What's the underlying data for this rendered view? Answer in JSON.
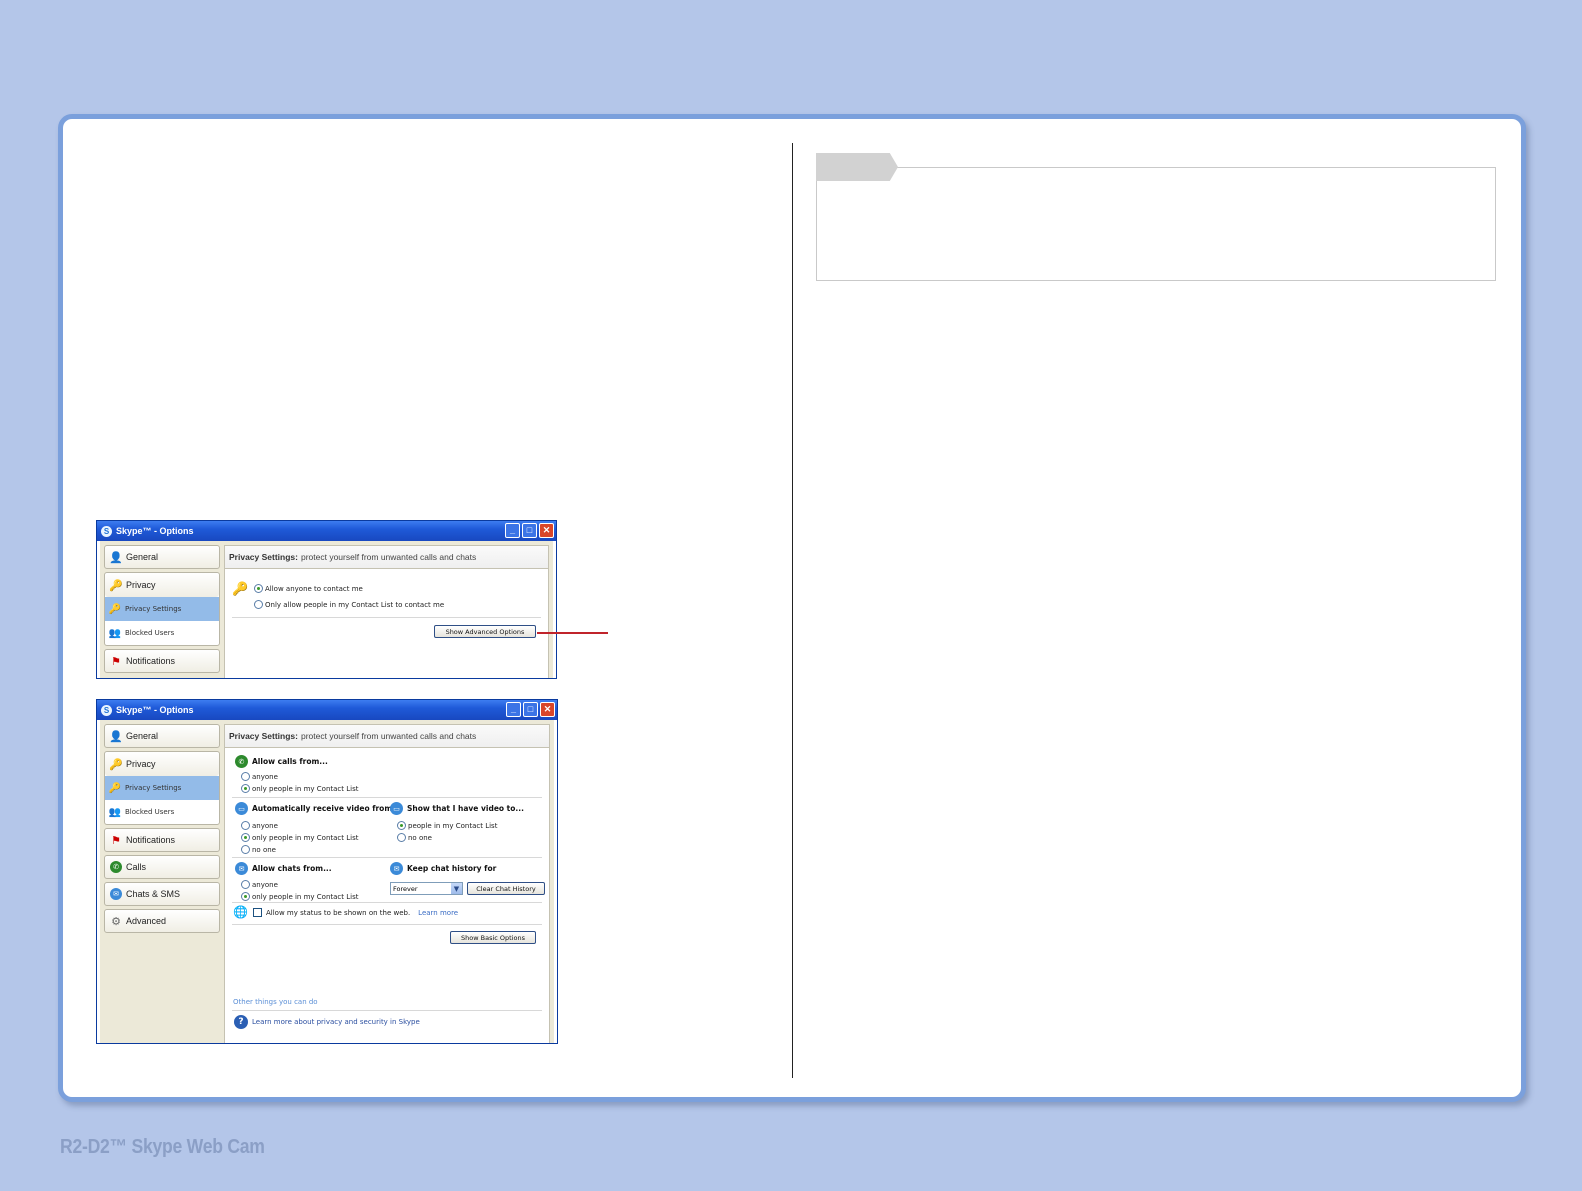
{
  "footer": {
    "title": "R2-D2™ Skype Web Cam"
  },
  "window1": {
    "title": "Skype™ - Options",
    "nav": {
      "general": "General",
      "privacy": "Privacy",
      "privacy_settings": "Privacy Settings",
      "blocked_users": "Blocked Users",
      "notifications": "Notifications"
    },
    "header_bold": "Privacy Settings:",
    "header_text": "protect yourself from unwanted calls and chats",
    "option_anyone": "Allow anyone to contact me",
    "option_contacts": "Only allow people in my Contact List to contact me",
    "advanced_button": "Show Advanced Options"
  },
  "window2": {
    "title": "Skype™ - Options",
    "nav": {
      "general": "General",
      "privacy": "Privacy",
      "privacy_settings": "Privacy Settings",
      "blocked_users": "Blocked Users",
      "notifications": "Notifications",
      "calls": "Calls",
      "chats_sms": "Chats & SMS",
      "advanced": "Advanced"
    },
    "header_bold": "Privacy Settings:",
    "header_text": "protect yourself from unwanted calls and chats",
    "calls": {
      "title": "Allow calls from...",
      "anyone": "anyone",
      "contacts": "only people in my Contact List"
    },
    "video_receive": {
      "title": "Automatically receive video from...",
      "anyone": "anyone",
      "contacts": "only people in my Contact List",
      "noone": "no one"
    },
    "video_show": {
      "title": "Show that I have video to...",
      "contacts": "people in my Contact List",
      "noone": "no one"
    },
    "chats": {
      "title": "Allow chats from...",
      "anyone": "anyone",
      "contacts": "only people in my Contact List"
    },
    "history": {
      "title": "Keep chat history for",
      "selected": "Forever",
      "clear_button": "Clear Chat History"
    },
    "web_status": {
      "label": "Allow my status to be shown on the web.",
      "learn_more": "Learn more"
    },
    "basic_button": "Show Basic Options",
    "other_heading": "Other things you can do",
    "other_link": "Learn more about privacy and security in Skype"
  }
}
